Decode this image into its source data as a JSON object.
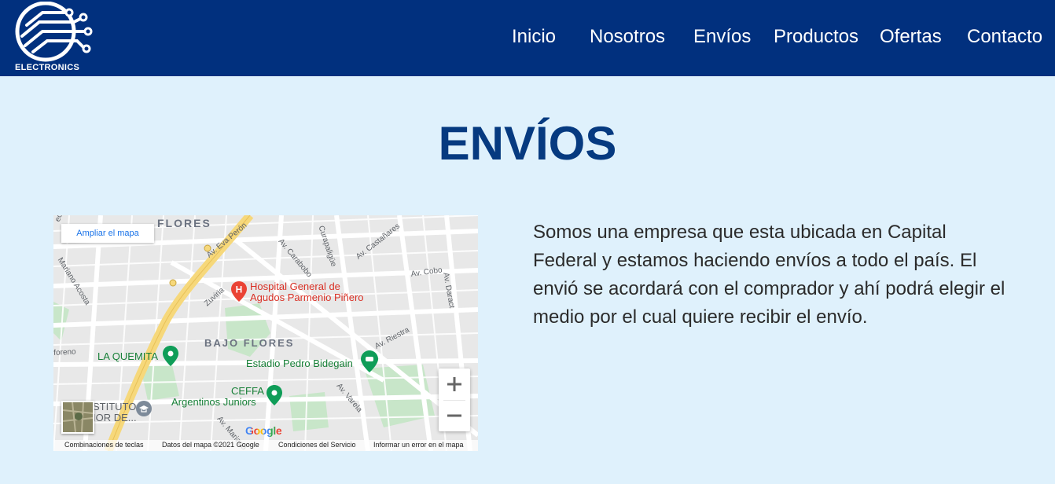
{
  "header": {
    "brand": "ELECTRONICS",
    "nav": [
      "Inicio",
      "Nosotros",
      "Envíos",
      "Productos",
      "Ofertas",
      "Contacto"
    ]
  },
  "page_title": "ENVÍOS",
  "map": {
    "enlarge_link": "Ampliar el mapa",
    "areas": {
      "flores": "FLORES",
      "bajo_flores": "BAJO FLORES"
    },
    "streets": {
      "eva_peron": "Av. Eva Perón",
      "carabobo": "Av. Carabobo",
      "curapaligue": "Curapaligüe",
      "castanares": "Av. Castañares",
      "cobo": "Av. Cobo",
      "daract": "Av. Daract",
      "zuviria": "Zuviria",
      "mariano_acosta": "Mariano Acosta",
      "riestra": "Av. Riestra",
      "varela": "Av. Varela",
      "moreno": "foreno",
      "ectrio": "ectrio",
      "av_mariano": "Av. Mariano"
    },
    "places": {
      "hospital": [
        "Hospital General de",
        "Agudos Parmenio Piñero"
      ],
      "la_quemita": "LA QUEMITA",
      "estadio": "Estadio Pedro Bidegain",
      "ceffa": [
        "CEFFA",
        "Argentinos Juniors"
      ],
      "instituto": [
        "STITUTO",
        "IOR DE..."
      ]
    },
    "google": "Google",
    "attribution": {
      "shortcuts": "Combinaciones de teclas",
      "data": "Datos del mapa ©2021 Google",
      "terms": "Condiciones del Servicio",
      "report": "Informar un error en el mapa"
    }
  },
  "description": "Somos una empresa que esta ubicada en Capital Federal y estamos haciendo envíos a todo el país. El envió se acordará con el comprador y ahí podrá elegir el medio por el cual quiere recibir el envío.",
  "colors": {
    "header_bg": "#01307e",
    "page_bg": "#dff1fc",
    "title": "#063a80",
    "highway": "#f6d87b"
  },
  "icons": [
    "logo-circuit-icon",
    "hospital-marker-icon",
    "place-marker-icon",
    "stadium-marker-icon",
    "school-icon",
    "zoom-in-icon",
    "zoom-out-icon"
  ]
}
